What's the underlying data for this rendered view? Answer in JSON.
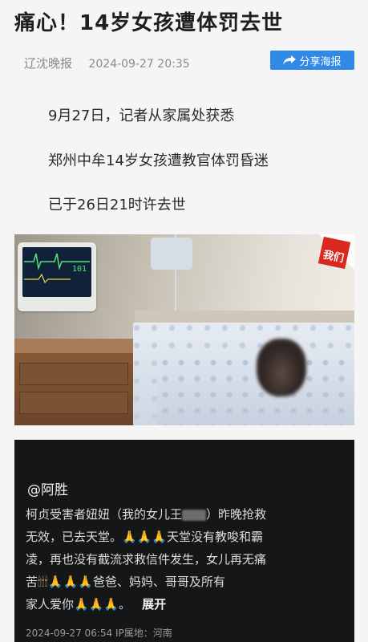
{
  "article": {
    "title": "痛心！14岁女孩遭体罚去世",
    "source": "辽沈晚报",
    "datetime": "2024-09-27 20:35",
    "share_label": "分享海报",
    "paragraphs": [
      "9月27日，记者从家属处获悉",
      "郑州中牟14岁女孩遭教官体罚昏迷",
      "已于26日21时许去世"
    ]
  },
  "photo": {
    "watermark": "我们",
    "monitor_reading": "101"
  },
  "post": {
    "author": "@阿胜",
    "line1_a": "柯贞受害者妞妞（我的女儿王",
    "line1_b": "）昨晚抢救",
    "line2": "无效，已去天堂。",
    "line2_tail": "天堂没有教唆和霸",
    "line3": "凌，再也没有截流求救信件发生，女儿再无痛",
    "line4_a": "苦",
    "line4_b": "爸爸、妈妈、哥哥及所有",
    "line5": "家人爱你",
    "more": "展开",
    "stamp": "2024-09-27 06:54  IP属地：河南"
  },
  "colors": {
    "accent": "#2f89e5",
    "post_bg": "#151618"
  }
}
